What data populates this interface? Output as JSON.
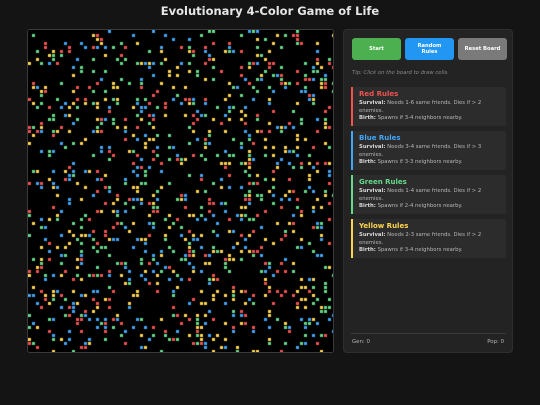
{
  "title": "Evolutionary 4-Color Game of Life",
  "controls": {
    "start_label": "Start",
    "random_label": "Random\nRules",
    "reset_label": "Reset Board"
  },
  "tip": "Tip: Click on the board to draw cells.",
  "rules": [
    {
      "title": "Red Rules",
      "color": "#ef5350",
      "survival_label": "Survival:",
      "survival_text": "Needs 1-6 same friends. Dies if > 2 enemies.",
      "birth_label": "Birth:",
      "birth_text": "Spawns if 3-4 neighbors nearby."
    },
    {
      "title": "Blue Rules",
      "color": "#42a5f5",
      "survival_label": "Survival:",
      "survival_text": "Needs 3-4 same friends. Dies if > 3 enemies.",
      "birth_label": "Birth:",
      "birth_text": "Spawns if 3-3 neighbors nearby."
    },
    {
      "title": "Green Rules",
      "color": "#66d98a",
      "survival_label": "Survival:",
      "survival_text": "Needs 1-4 same friends. Dies if > 2 enemies.",
      "birth_label": "Birth:",
      "birth_text": "Spawns if 2-4 neighbors nearby."
    },
    {
      "title": "Yellow Rules",
      "color": "#ffd54f",
      "survival_label": "Survival:",
      "survival_text": "Needs 2-3 same friends. Dies if > 2 enemies.",
      "birth_label": "Birth:",
      "birth_text": "Spawns if 3-4 neighbors nearby."
    }
  ],
  "stats": {
    "gen_label": "Gen:",
    "gen_value": "0",
    "pop_label": "Pop:",
    "pop_value": "0"
  },
  "board": {
    "cell_colors": [
      "#ef5350",
      "#42a5f5",
      "#66d98a",
      "#ffd54f"
    ],
    "background": "#000000"
  }
}
